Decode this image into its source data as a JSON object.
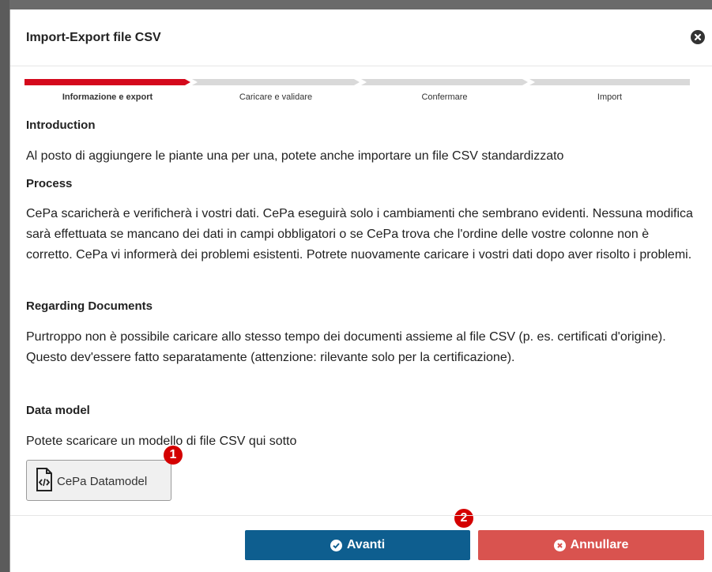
{
  "modal": {
    "title": "Import-Export file CSV"
  },
  "stepper": {
    "steps": [
      {
        "label": "Informazione e export",
        "active": true
      },
      {
        "label": "Caricare e validare",
        "active": false
      },
      {
        "label": "Confermare",
        "active": false
      },
      {
        "label": "Import",
        "active": false
      }
    ],
    "active_color": "#d4091c",
    "inactive_color": "#d9d9d9"
  },
  "sections": {
    "intro_title": "Introduction",
    "intro_text": "Al posto di aggiungere le piante una per una, potete anche importare un file CSV standardizzato",
    "process_title": "Process",
    "process_text": "CePa scaricherà e verificherà i vostri dati. CePa eseguirà solo i cambiamenti che sembrano evidenti. Nessuna modifica sarà effettuata se mancano dei dati in campi obbligatori o se CePa trova che l'ordine delle vostre colonne non è corretto. CePa vi informerà dei problemi esistenti. Potrete nuovamente caricare i vostri dati dopo aver risolto i problemi.",
    "documents_title": "Regarding Documents",
    "documents_text": "Purtroppo non è possibile caricare allo stesso tempo dei documenti assieme al file CSV (p. es. certificati d'origine). Questo dev'essere fatto separatamente (attenzione: rilevante solo per la certificazione).",
    "datamodel_title": "Data model",
    "datamodel_text": "Potete scaricare un modello di file CSV qui sotto"
  },
  "datamodel_button": {
    "label": "CePa Datamodel",
    "icon": "file-code-icon"
  },
  "badges": {
    "one": "1",
    "two": "2"
  },
  "footer": {
    "next_label": "Avanti",
    "cancel_label": "Annullare",
    "next_color": "#0e5e8f",
    "cancel_color": "#d9534f"
  }
}
